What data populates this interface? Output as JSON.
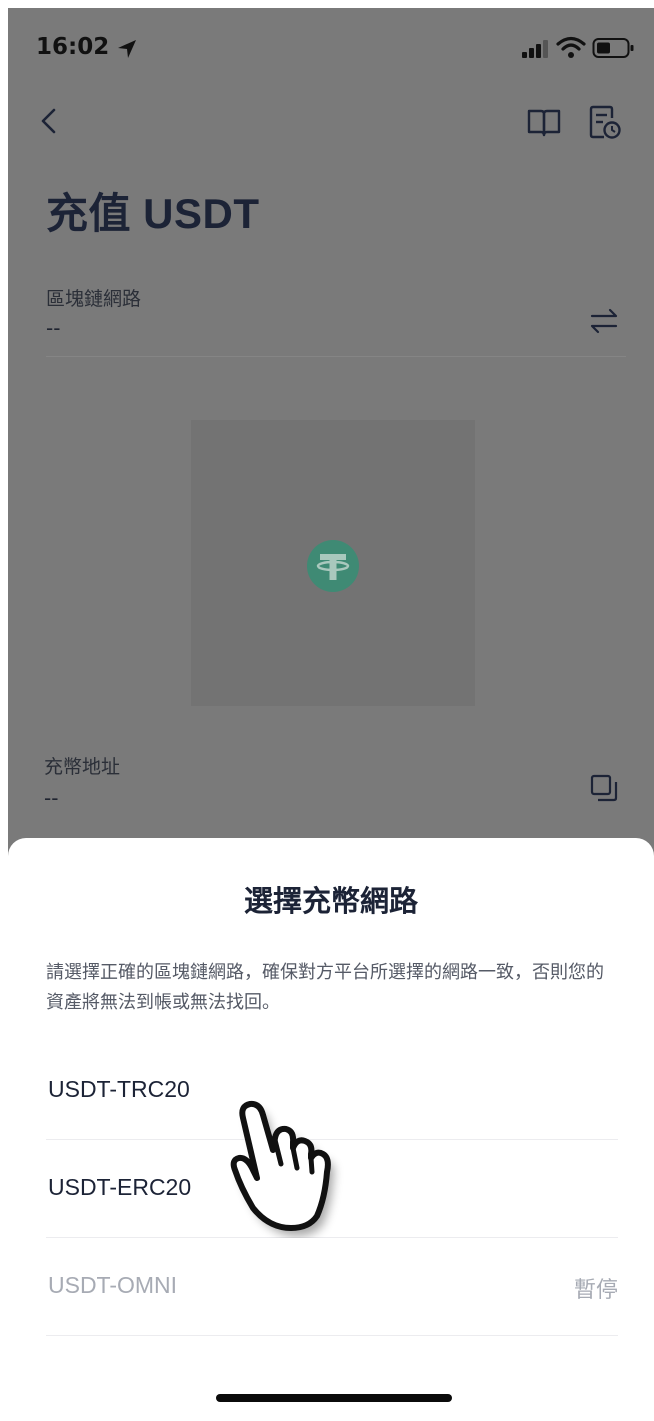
{
  "status_bar": {
    "time": "16:02"
  },
  "header": {
    "title": "充值 USDT"
  },
  "network_field": {
    "label": "區塊鏈網路",
    "value": "--"
  },
  "address_field": {
    "label": "充幣地址",
    "value": "--"
  },
  "sheet": {
    "title": "選擇充幣網路",
    "description": "請選擇正確的區塊鏈網路，確保對方平台所選擇的網路一致，否則您的資產將無法到帳或無法找回。",
    "options": [
      {
        "label": "USDT-TRC20",
        "status": ""
      },
      {
        "label": "USDT-ERC20",
        "status": ""
      },
      {
        "label": "USDT-OMNI",
        "status": "暫停"
      }
    ]
  },
  "colors": {
    "overlay": "#7a7a7a",
    "title_text": "#1c2336",
    "disabled_text": "#a7abb4",
    "tether_green": "#3f8a74"
  },
  "icons": [
    "location-arrow-icon",
    "signal-icon",
    "wifi-icon",
    "battery-icon",
    "back-chevron-icon",
    "book-icon",
    "record-icon",
    "switch-arrows-icon",
    "copy-icon",
    "tether-icon",
    "pointer-hand-icon"
  ]
}
